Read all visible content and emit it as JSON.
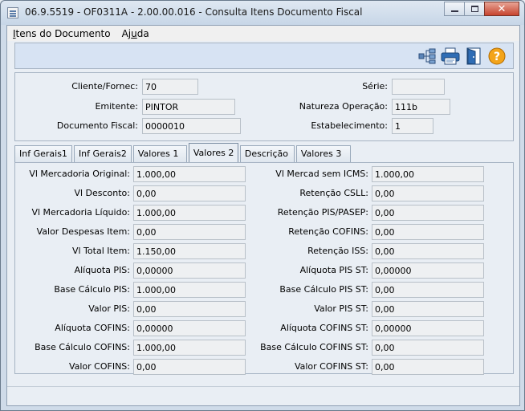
{
  "window": {
    "title": "06.9.5519 - OF0311A - 2.00.00.016 - Consulta Itens Documento Fiscal",
    "close_glyph": "✕"
  },
  "menu": [
    {
      "accel": "I",
      "rest": "tens do Documento"
    },
    {
      "pre": "Aj",
      "accel": "u",
      "rest": "da"
    }
  ],
  "toolbar": {
    "icons": [
      "hierarchy-icon",
      "print-icon",
      "exit-door-icon",
      "help-icon"
    ],
    "help_glyph": "?"
  },
  "header": {
    "cliente_label": "Cliente/Fornec:",
    "cliente_value": "70",
    "emitente_label": "Emitente:",
    "emitente_value": "PINTOR",
    "documento_label": "Documento Fiscal:",
    "documento_value": "0000010",
    "serie_label": "Série:",
    "serie_value": "",
    "natureza_label": "Natureza Operação:",
    "natureza_value": "111b",
    "estabelecimento_label": "Estabelecimento:",
    "estabelecimento_value": "1"
  },
  "tabs": [
    "Inf Gerais1",
    "Inf Gerais2",
    "Valores 1",
    "Valores 2",
    "Descrição",
    "Valores 3"
  ],
  "active_tab": "Valores 2",
  "left_fields": [
    {
      "label": "Vl Mercadoria Original:",
      "value": "1.000,00"
    },
    {
      "label": "Vl Desconto:",
      "value": "0,00"
    },
    {
      "label": "Vl Mercadoria Líquido:",
      "value": "1.000,00"
    },
    {
      "label": "Valor Despesas Item:",
      "value": "0,00"
    },
    {
      "label": "Vl Total Item:",
      "value": "1.150,00"
    },
    {
      "label": "Alíquota PIS:",
      "value": "0,00000"
    },
    {
      "label": "Base Cálculo PIS:",
      "value": "1.000,00"
    },
    {
      "label": "Valor PIS:",
      "value": "0,00"
    },
    {
      "label": "Alíquota COFINS:",
      "value": "0,00000"
    },
    {
      "label": "Base Cálculo COFINS:",
      "value": "1.000,00"
    },
    {
      "label": "Valor COFINS:",
      "value": "0,00"
    }
  ],
  "right_fields": [
    {
      "label": "Vl Mercad sem ICMS:",
      "value": "1.000,00"
    },
    {
      "label": "Retenção CSLL:",
      "value": "0,00"
    },
    {
      "label": "Retenção PIS/PASEP:",
      "value": "0,00"
    },
    {
      "label": "Retenção COFINS:",
      "value": "0,00"
    },
    {
      "label": "Retenção ISS:",
      "value": "0,00"
    },
    {
      "label": "Alíquota PIS ST:",
      "value": "0,00000"
    },
    {
      "label": "Base Cálculo PIS ST:",
      "value": "0,00"
    },
    {
      "label": "Valor PIS ST:",
      "value": "0,00"
    },
    {
      "label": "Alíquota COFINS ST:",
      "value": "0,00000"
    },
    {
      "label": "Base Cálculo COFINS ST:",
      "value": "0,00"
    },
    {
      "label": "Valor COFINS ST:",
      "value": "0,00"
    }
  ]
}
